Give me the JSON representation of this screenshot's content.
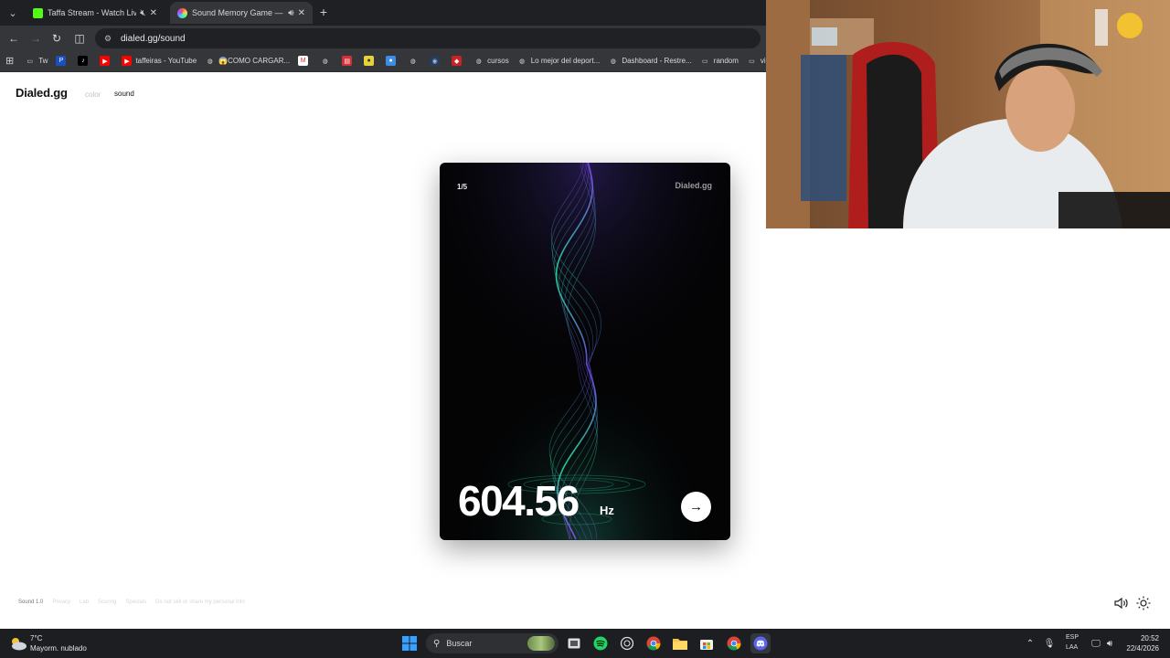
{
  "browser": {
    "tabs": [
      {
        "title": "Taffa Stream - Watch Live o",
        "favicon_color": "#53fc18",
        "muted": true
      },
      {
        "title": "Sound Memory Game — Hc",
        "favicon_color": "#7b61ff",
        "audio": true
      }
    ],
    "url": "dialed.gg/sound",
    "bookmarks": [
      {
        "label": "Tw",
        "icon": "folder-icon"
      },
      {
        "label": "",
        "icon": "paypal-icon"
      },
      {
        "label": "",
        "icon": "tiktok-icon"
      },
      {
        "label": "",
        "icon": "youtube-icon"
      },
      {
        "label": "taffeiras - YouTube",
        "icon": "youtube-icon"
      },
      {
        "label": "😱COMO CARGAR...",
        "icon": "globe-icon"
      },
      {
        "label": "",
        "icon": "gmail-icon"
      },
      {
        "label": "",
        "icon": "globe-icon"
      },
      {
        "label": "",
        "icon": "red-app-icon"
      },
      {
        "label": "",
        "icon": "yellow-app-icon"
      },
      {
        "label": "",
        "icon": "blue-app-icon"
      },
      {
        "label": "",
        "icon": "globe-icon"
      },
      {
        "label": "",
        "icon": "dark-app-icon"
      },
      {
        "label": "",
        "icon": "shield-icon"
      },
      {
        "label": "cursos",
        "icon": "globe-icon"
      },
      {
        "label": "Lo mejor del deport...",
        "icon": "globe-icon"
      },
      {
        "label": "Dashboard - Restre...",
        "icon": "globe-icon"
      },
      {
        "label": "random",
        "icon": "folder-icon"
      },
      {
        "label": "vi",
        "icon": "folder-icon"
      }
    ]
  },
  "page": {
    "logo": "Dialed.gg",
    "nav": {
      "color": "color",
      "sound": "sound"
    },
    "card": {
      "counter": "1/5",
      "brand": "Dialed.gg",
      "frequency": "604.56",
      "unit": "Hz",
      "next_icon": "arrow-right-icon"
    },
    "footer": [
      "Sound 1.0",
      "Privacy",
      "Lab",
      "Scoring",
      "Specials",
      "Do not sell or share my personal info"
    ],
    "controls": {
      "volume_icon": "speaker-icon",
      "theme_icon": "sun-icon"
    }
  },
  "taskbar": {
    "weather": {
      "temp": "7°C",
      "condition": "Mayorm. nublado"
    },
    "search_placeholder": "Buscar",
    "lang_line1": "ESP",
    "lang_line2": "LAA",
    "time": "20:52",
    "date": "22/4/2026"
  },
  "colors": {
    "card_bg": "#040405",
    "wave_teal": "#26d3a0",
    "wave_purple": "#7b3fe4",
    "chrome_dark": "#1f2024",
    "taskbar": "#1c1e22"
  }
}
